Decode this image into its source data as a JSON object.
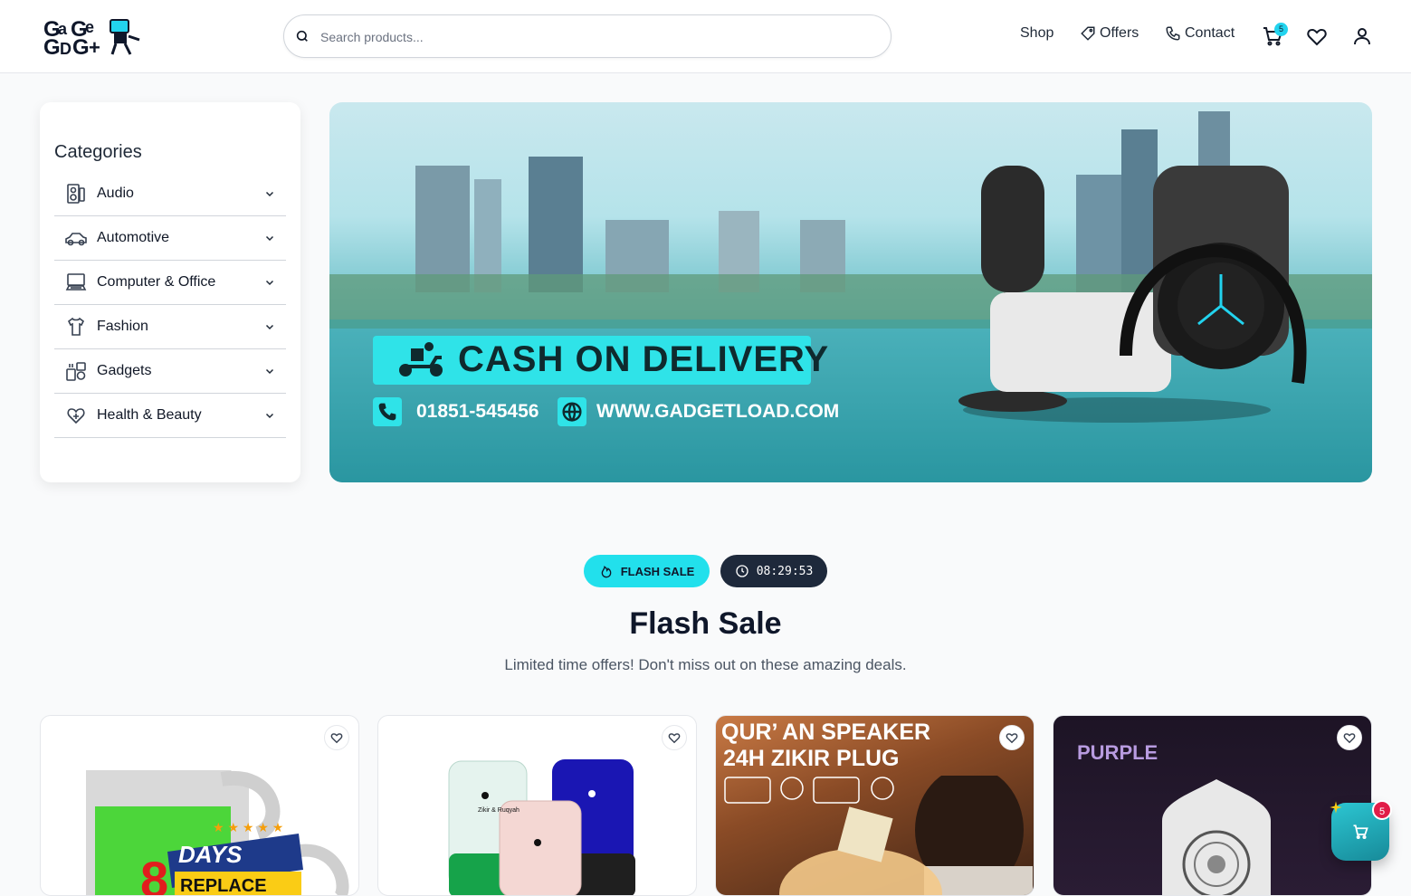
{
  "header": {
    "logo_alt": "Gadget logo",
    "search_placeholder": "Search products...",
    "nav": {
      "shop": "Shop",
      "offers": "Offers",
      "contact": "Contact"
    },
    "cart_count": "5"
  },
  "sidebar": {
    "title": "Categories",
    "items": [
      {
        "label": "Audio",
        "icon": "speaker-icon"
      },
      {
        "label": "Automotive",
        "icon": "car-icon"
      },
      {
        "label": "Computer & Office",
        "icon": "computer-icon"
      },
      {
        "label": "Fashion",
        "icon": "fashion-icon"
      },
      {
        "label": "Gadgets",
        "icon": "gadgets-icon"
      },
      {
        "label": "Health & Beauty",
        "icon": "health-icon"
      }
    ]
  },
  "banner": {
    "headline": "CASH ON DELIVERY",
    "phone": "01851-545456",
    "website": "WWW.GADGETLOAD.COM"
  },
  "flash": {
    "pill_label": "FLASH SALE",
    "timer": "08:29:53",
    "title": "Flash Sale",
    "subtitle": "Limited time offers! Don't miss out on these amazing deals."
  },
  "products": [
    {
      "overlay_text_1": "8",
      "overlay_text_2": "DAYS",
      "overlay_text_3": "REPLACE"
    },
    {
      "overlay_text_1": "Zikir & Ruqyah"
    },
    {
      "overlay_text_1": "QUR’ AN SPEAKER",
      "overlay_text_2": "24H ZIKIR PLUG"
    },
    {
      "overlay_text_1": "PURPLE"
    }
  ],
  "floating_cart": {
    "count": "5"
  },
  "colors": {
    "accent": "#22e0ec",
    "dark": "#1e293b",
    "badge": "#e11d48"
  }
}
